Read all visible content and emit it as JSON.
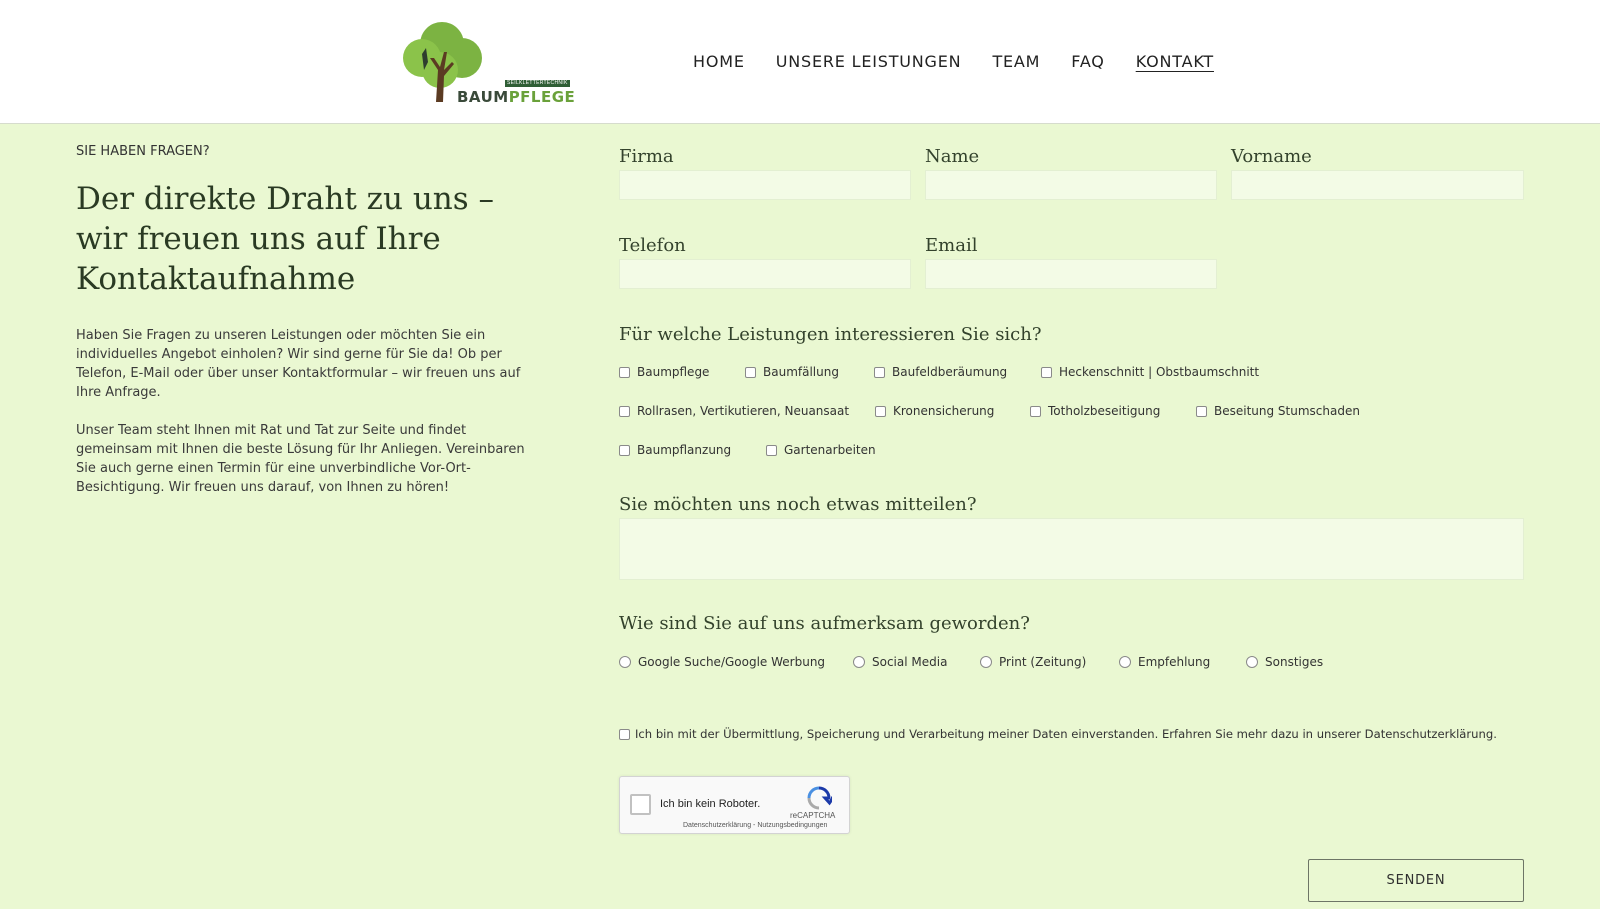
{
  "logo": {
    "word_a": "BAUM",
    "word_b": "PFLEGE",
    "tagline": "SEILKLETTERTECHNIK"
  },
  "nav": {
    "items": [
      "HOME",
      "UNSERE LEISTUNGEN",
      "TEAM",
      "FAQ",
      "KONTAKT"
    ],
    "active": "KONTAKT"
  },
  "intro": {
    "eyebrow": "SIE HABEN FRAGEN?",
    "headline": "Der direkte Draht zu uns – wir freuen uns auf Ihre Kontaktaufnahme",
    "paragraph1": "Haben Sie Fragen zu unseren Leistungen oder möchten Sie ein individuelles Angebot einholen? Wir sind gerne für Sie da! Ob per Telefon, E-Mail oder über unser Kontaktformular – wir freuen uns auf Ihre Anfrage.",
    "paragraph2": "Unser Team steht Ihnen mit Rat und Tat zur Seite und findet gemeinsam mit Ihnen die beste Lösung für Ihr Anliegen. Vereinbaren Sie auch gerne einen Termin für eine unverbindliche Vor-Ort-Besichtigung. Wir freuen uns darauf, von Ihnen zu hören!"
  },
  "form": {
    "labels": {
      "firma": "Firma",
      "name": "Name",
      "vorname": "Vorname",
      "telefon": "Telefon",
      "email": "Email"
    },
    "values": {
      "firma": "",
      "name": "",
      "vorname": "",
      "telefon": "",
      "email": ""
    },
    "services_question": "Für welche Leistungen interessieren Sie sich?",
    "services": [
      "Baumpflege",
      "Baumfällung",
      "Baufeldberäumung",
      "Heckenschnitt | Obstbaumschnitt",
      "Rollrasen, Vertikutieren, Neuansaat",
      "Kronensicherung",
      "Totholzbeseitigung",
      "Beseitung Stumschaden",
      "Baumpflanzung",
      "Gartenarbeiten"
    ],
    "message_question": "Sie möchten uns noch etwas mitteilen?",
    "message_value": "",
    "source_question": "Wie sind Sie auf uns aufmerksam geworden?",
    "sources": [
      "Google Suche/Google Werbung",
      "Social Media",
      "Print (Zeitung)",
      "Empfehlung",
      "Sonstiges"
    ],
    "consent": "Ich bin mit der Übermittlung, Speicherung und Verarbeitung meiner Daten einverstanden. Erfahren Sie mehr dazu in unserer Datenschutzerklärung.",
    "recaptcha": {
      "label": "Ich bin kein Roboter.",
      "brand": "reCAPTCHA",
      "links": "Datenschutzerklärung - Nutzungsbedingungen"
    },
    "submit": "SENDEN"
  }
}
